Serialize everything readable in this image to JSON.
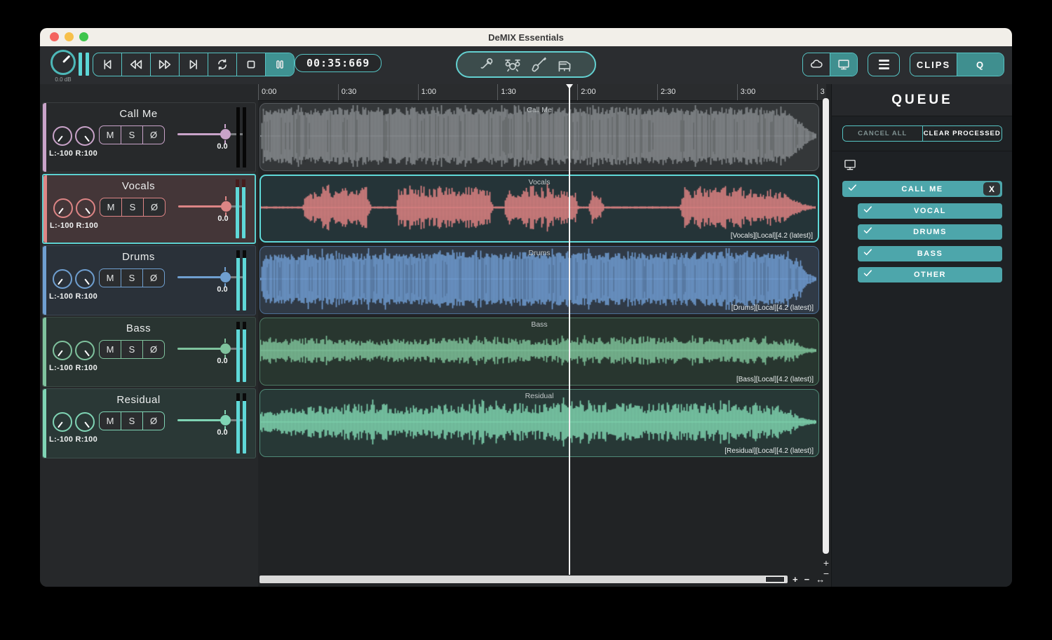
{
  "window": {
    "title": "DeMIX Essentials"
  },
  "toolbar": {
    "gain_label": "0.0 dB",
    "time": "00:35:669",
    "clips_label": "CLIPS",
    "queue_btn_label": "Q",
    "transport": [
      "skip-start",
      "rewind",
      "fast-forward",
      "skip-end",
      "loop",
      "stop",
      "pause"
    ],
    "instruments": [
      "microphone",
      "drums",
      "guitar",
      "piano"
    ],
    "accent": "#56c4c4"
  },
  "ruler": {
    "ticks": [
      "0:00",
      "0:30",
      "1:00",
      "1:30",
      "2:00",
      "2:30",
      "3:00",
      "3"
    ]
  },
  "controls": {
    "mute": "M",
    "solo": "S",
    "phase": "Ø"
  },
  "tracks": [
    {
      "name": "Call Me",
      "pan": "L:-100 R:100",
      "gain": "0.0",
      "version": "",
      "accent": "#c9a3c9",
      "header_bg": "#27292b",
      "header_border": "#3a3d3f",
      "clip_bg": "#343739",
      "clip_border": "#55595d",
      "wave_color": "#85898c",
      "selected": false,
      "meter": "off",
      "meter_cap": "#070707",
      "waveform": {
        "style": "full",
        "seed": 11,
        "env": [
          [
            0,
            0
          ],
          [
            0.005,
            0.88
          ],
          [
            0.5,
            0.93
          ],
          [
            0.9,
            0.9
          ],
          [
            0.945,
            0.8
          ],
          [
            0.975,
            0.35
          ],
          [
            0.99,
            0.12
          ],
          [
            1,
            0.05
          ]
        ]
      }
    },
    {
      "name": "Vocals",
      "pan": "L:-100 R:100",
      "gain": "0.0",
      "version": "[Vocals][Local][4.2 (latest)]",
      "accent": "#dd8585",
      "header_bg": "#443638",
      "header_border": "#5a4547",
      "clip_bg": "#253438",
      "clip_border": "#5fd8d8",
      "wave_color": "#dd8282",
      "selected": true,
      "meter": "on",
      "meter_cap": "#451d1d",
      "waveform": {
        "style": "center",
        "seed": 22,
        "env": [
          [
            0,
            0.012
          ],
          [
            0.075,
            0.012
          ],
          [
            0.082,
            0.5
          ],
          [
            0.12,
            0.62
          ],
          [
            0.16,
            0.5
          ],
          [
            0.19,
            0.58
          ],
          [
            0.198,
            0.012
          ],
          [
            0.243,
            0.012
          ],
          [
            0.25,
            0.58
          ],
          [
            0.3,
            0.65
          ],
          [
            0.36,
            0.55
          ],
          [
            0.41,
            0.6
          ],
          [
            0.418,
            0.012
          ],
          [
            0.438,
            0.012
          ],
          [
            0.443,
            0.55
          ],
          [
            0.5,
            0.6
          ],
          [
            0.55,
            0.5
          ],
          [
            0.565,
            0.55
          ],
          [
            0.572,
            0.012
          ],
          [
            0.59,
            0.012
          ],
          [
            0.595,
            0.45
          ],
          [
            0.612,
            0.4
          ],
          [
            0.618,
            0.012
          ],
          [
            0.755,
            0.012
          ],
          [
            0.762,
            0.55
          ],
          [
            0.82,
            0.6
          ],
          [
            0.88,
            0.55
          ],
          [
            0.93,
            0.5
          ],
          [
            0.965,
            0.18
          ],
          [
            0.985,
            0.05
          ],
          [
            1,
            0.012
          ]
        ]
      }
    },
    {
      "name": "Drums",
      "pan": "L:-100 R:100",
      "gain": "0.0",
      "version": "[Drums][Local][4.2 (latest)]",
      "accent": "#6f9fd0",
      "header_bg": "#2a3139",
      "header_border": "#3c4754",
      "clip_bg": "#303a46",
      "clip_border": "#4c6f96",
      "wave_color": "#6f9bd0",
      "selected": false,
      "meter": "on",
      "meter_cap": "#0a0a0a",
      "waveform": {
        "style": "full",
        "seed": 33,
        "env": [
          [
            0,
            0.02
          ],
          [
            0.006,
            0.78
          ],
          [
            0.3,
            0.85
          ],
          [
            0.6,
            0.82
          ],
          [
            0.9,
            0.86
          ],
          [
            0.94,
            0.8
          ],
          [
            0.97,
            0.5
          ],
          [
            0.985,
            0.15
          ],
          [
            1,
            0.03
          ]
        ]
      }
    },
    {
      "name": "Bass",
      "pan": "L:-100 R:100",
      "gain": "0.0",
      "version": "[Bass][Local][4.2 (latest)]",
      "accent": "#7fc29d",
      "header_bg": "#293431",
      "header_border": "#3b4a44",
      "clip_bg": "#28362f",
      "clip_border": "#4d7a64",
      "wave_color": "#7dc098",
      "selected": false,
      "meter": "on",
      "meter_cap": "#0a0a0a",
      "waveform": {
        "style": "center",
        "seed": 44,
        "env": [
          [
            0,
            0.3
          ],
          [
            0.1,
            0.34
          ],
          [
            0.18,
            0.27
          ],
          [
            0.3,
            0.32
          ],
          [
            0.42,
            0.36
          ],
          [
            0.5,
            0.3
          ],
          [
            0.62,
            0.35
          ],
          [
            0.72,
            0.38
          ],
          [
            0.82,
            0.32
          ],
          [
            0.9,
            0.34
          ],
          [
            0.955,
            0.3
          ],
          [
            0.972,
            0.1
          ],
          [
            1,
            0.02
          ]
        ]
      }
    },
    {
      "name": "Residual",
      "pan": "L:-100 R:100",
      "gain": "0.0",
      "version": "[Residual][Local][4.2 (latest)]",
      "accent": "#7fd4b4",
      "header_bg": "#2a3836",
      "header_border": "#3d4f4c",
      "clip_bg": "#273836",
      "clip_border": "#4f8a77",
      "wave_color": "#7ed2ae",
      "selected": false,
      "meter": "on",
      "meter_cap": "#0a0a0a",
      "waveform": {
        "style": "center",
        "seed": 55,
        "env": [
          [
            0,
            0.3
          ],
          [
            0.08,
            0.42
          ],
          [
            0.2,
            0.5
          ],
          [
            0.3,
            0.44
          ],
          [
            0.42,
            0.52
          ],
          [
            0.5,
            0.46
          ],
          [
            0.58,
            0.6
          ],
          [
            0.68,
            0.48
          ],
          [
            0.78,
            0.52
          ],
          [
            0.88,
            0.46
          ],
          [
            0.945,
            0.42
          ],
          [
            0.968,
            0.15
          ],
          [
            1,
            0.03
          ]
        ]
      }
    }
  ],
  "queue": {
    "title": "QUEUE",
    "cancel_all": "CANCEL ALL",
    "clear_processed": "CLEAR PROCESSED",
    "job": {
      "name": "CALL ME",
      "close_label": "X",
      "stems": [
        {
          "label": "VOCAL"
        },
        {
          "label": "DRUMS"
        },
        {
          "label": "BASS"
        },
        {
          "label": "OTHER"
        }
      ]
    }
  },
  "scrollbars": {
    "zoom_in": "+",
    "zoom_out": "−",
    "fit": "↔"
  }
}
